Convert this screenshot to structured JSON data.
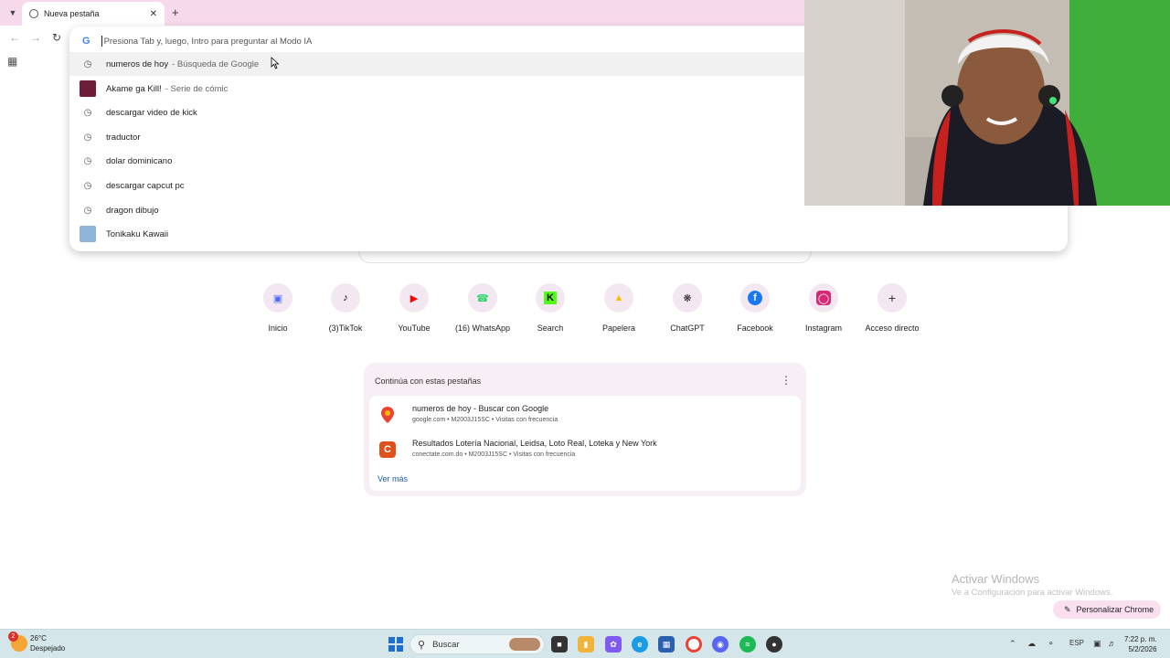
{
  "browser": {
    "tab_title": "Nueva pestaña",
    "omnibox_placeholder": "Presiona Tab y, luego, Intro para preguntar al Modo IA"
  },
  "suggestions": [
    {
      "text": "numeros de hoy",
      "desc": "- Búsqueda de Google",
      "icon": "history-icon",
      "highlighted": true
    },
    {
      "text": "Akame ga Kill!",
      "desc": "- Serie de cómic",
      "icon": "thumbnail",
      "thumb_color": "#6b1d3a"
    },
    {
      "text": "descargar video de kick",
      "desc": "",
      "icon": "history-icon"
    },
    {
      "text": "traductor",
      "desc": "",
      "icon": "history-icon"
    },
    {
      "text": "dolar dominicano",
      "desc": "",
      "icon": "history-icon"
    },
    {
      "text": "descargar capcut pc",
      "desc": "",
      "icon": "history-icon"
    },
    {
      "text": "dragon dibujo",
      "desc": "",
      "icon": "history-icon"
    },
    {
      "text": "Tonikaku Kawaii",
      "desc": "",
      "icon": "thumbnail",
      "thumb_color": "#8fb5d8"
    }
  ],
  "shortcuts": [
    {
      "label": "Inicio",
      "icon": "inicio-icon",
      "color": "#4f6ef7"
    },
    {
      "label": "(3)TikTok",
      "icon": "tiktok-icon",
      "color": "#000000"
    },
    {
      "label": "YouTube",
      "icon": "youtube-icon",
      "color": "#ff0000"
    },
    {
      "label": "(16) WhatsApp",
      "icon": "whatsapp-icon",
      "color": "#25d366"
    },
    {
      "label": "Search",
      "icon": "kick-icon",
      "color": "#53fc18"
    },
    {
      "label": "Papelera",
      "icon": "drive-icon",
      "color": "#fbbc04"
    },
    {
      "label": "ChatGPT",
      "icon": "chatgpt-icon",
      "color": "#222222"
    },
    {
      "label": "Facebook",
      "icon": "facebook-icon",
      "color": "#1877f2"
    },
    {
      "label": "Instagram",
      "icon": "instagram-icon",
      "color": "#d62976"
    },
    {
      "label": "Acceso directo",
      "icon": "plus-icon",
      "color": "#333333"
    }
  ],
  "continue_card": {
    "title": "Continúa con estas pestañas",
    "items": [
      {
        "title": "numeros de hoy - Buscar con Google",
        "sub": "google.com • M2003J15SC • Visitas con frecuencia",
        "icon": "maps-icon",
        "color": "#ea4335"
      },
      {
        "title": "Resultados Lotería Nacional, Leidsa, Loto Real, Loteka y New York",
        "sub": "conectate.com.do • M2003J15SC • Visitas con frecuencia",
        "icon": "conectate-icon",
        "color": "#e0501b"
      }
    ],
    "more": "Ver más"
  },
  "watermark": {
    "line1": "Activar Windows",
    "line2": "Ve a Configuración para activar Windows."
  },
  "customize_label": "Personalizar Chrome",
  "taskbar": {
    "weather_temp": "26°C",
    "weather_desc": "Despejado",
    "weather_badge": "2",
    "search_label": "Buscar",
    "lang": "ESP",
    "time": "7:22 p. m.",
    "date": "5/2/2026"
  }
}
